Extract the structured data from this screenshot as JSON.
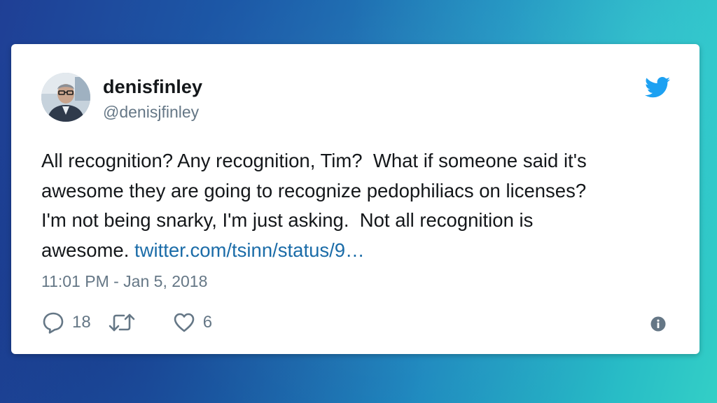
{
  "tweet": {
    "display_name": "denisfinley",
    "handle": "@denisjfinley",
    "text": "All recognition? Any recognition, Tim?  What if someone said it's\nawesome they are going to recognize pedophiliacs on licenses?\nI'm not being snarky, I'm just asking.  Not all recognition is\nawesome. ",
    "link_text": "twitter.com/tsinn/status/9…",
    "timestamp": "11:01 PM - Jan 5, 2018"
  },
  "actions": {
    "reply": {
      "icon": "reply-icon",
      "count": "18"
    },
    "retweet": {
      "icon": "retweet-icon",
      "count": ""
    },
    "like": {
      "icon": "heart-icon",
      "count": "6"
    },
    "info": {
      "icon": "info-icon"
    }
  },
  "colors": {
    "twitter_blue": "#1da1f2",
    "link": "#1b6ca8",
    "muted": "#657786",
    "text": "#14171a"
  }
}
